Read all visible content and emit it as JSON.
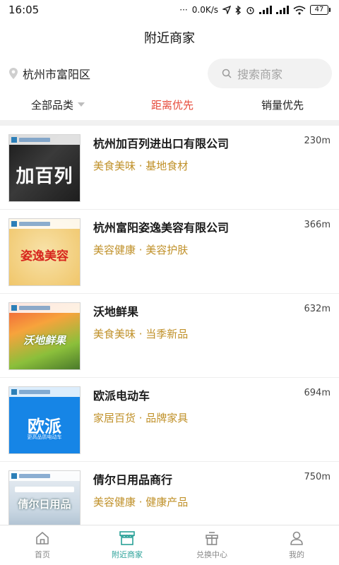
{
  "status": {
    "time": "16:05",
    "speed": "0.0K/s",
    "battery": "47"
  },
  "header": {
    "title": "附近商家"
  },
  "location": {
    "label": "杭州市富阳区"
  },
  "search": {
    "placeholder": "搜索商家"
  },
  "filters": [
    {
      "label": "全部品类"
    },
    {
      "label": "距离优先"
    },
    {
      "label": "销量优先"
    }
  ],
  "shops": [
    {
      "name": "杭州加百列进出口有限公司",
      "tags": "美食美味 · 基地食材",
      "distance": "230m",
      "thumb_text": "加百列"
    },
    {
      "name": "杭州富阳姿逸美容有限公司",
      "tags": "美容健康 · 美容护肤",
      "distance": "366m",
      "thumb_text": "姿逸美容"
    },
    {
      "name": "沃地鲜果",
      "tags": "美食美味 · 当季新品",
      "distance": "632m",
      "thumb_text": "沃地鲜果"
    },
    {
      "name": "欧派电动车",
      "tags": "家居百货 · 品牌家具",
      "distance": "694m",
      "thumb_text": "欧派",
      "thumb_sub": "更高品质电动车"
    },
    {
      "name": "倩尔日用品商行",
      "tags": "美容健康 · 健康产品",
      "distance": "750m",
      "thumb_text": "倩尔日用品"
    }
  ],
  "tabs": [
    {
      "label": "首页",
      "icon": "home-icon"
    },
    {
      "label": "附近商家",
      "icon": "store-icon"
    },
    {
      "label": "兑换中心",
      "icon": "gift-icon"
    },
    {
      "label": "我的",
      "icon": "user-icon"
    }
  ],
  "colors": {
    "accent": "#2aa198",
    "active_filter": "#e74c3c",
    "tag": "#c0912a"
  }
}
